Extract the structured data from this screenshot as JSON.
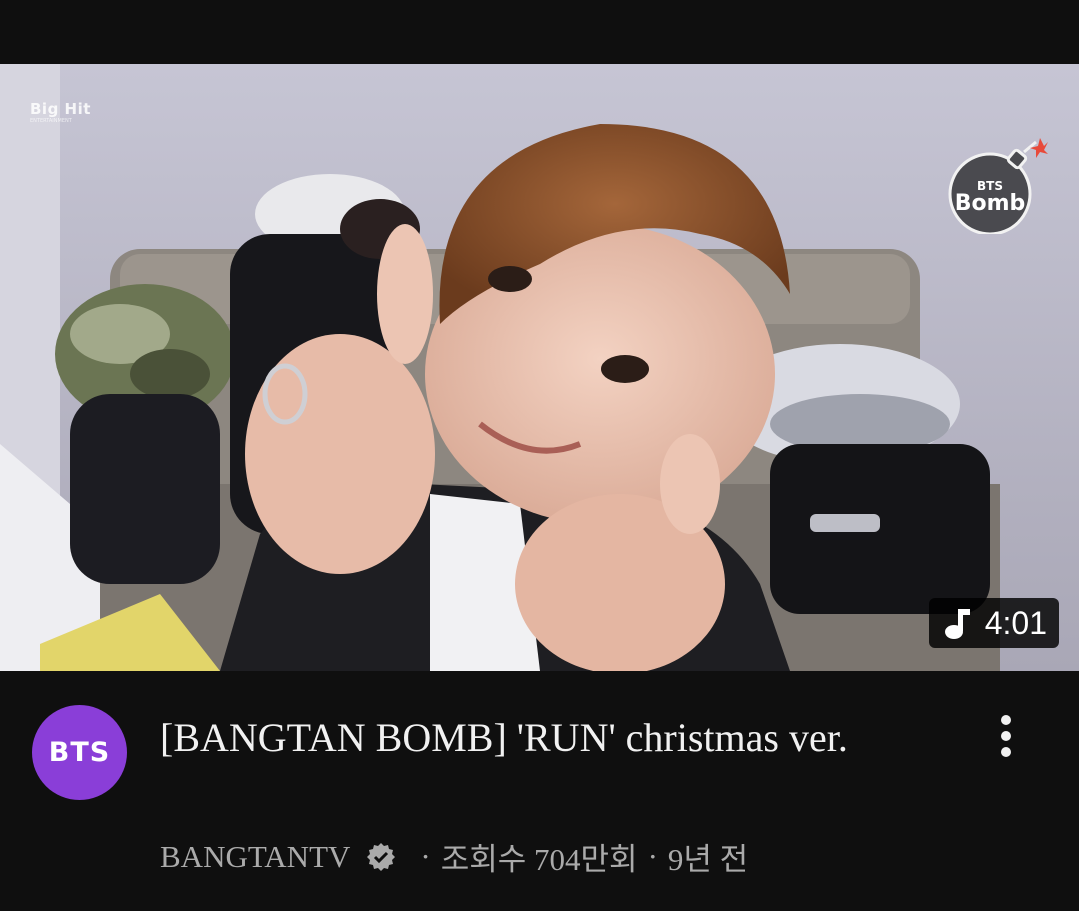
{
  "video": {
    "watermark_left": "Big Hit",
    "watermark_left_sub": "ENTERTAINMENT",
    "watermark_right": "BTS Bomb",
    "duration": "4:01",
    "duration_icon": "music-note-icon"
  },
  "channel": {
    "avatar_text": "BTS",
    "avatar_color": "#8a3ed8",
    "name": "BANGTANTV",
    "verified_icon": "verified-badge-icon"
  },
  "details": {
    "title": "[BANGTAN BOMB] 'RUN' christmas ver.",
    "separator": "·",
    "views": "조회수 704만회",
    "age": "9년 전"
  },
  "menu_icon": "more-vertical-icon"
}
